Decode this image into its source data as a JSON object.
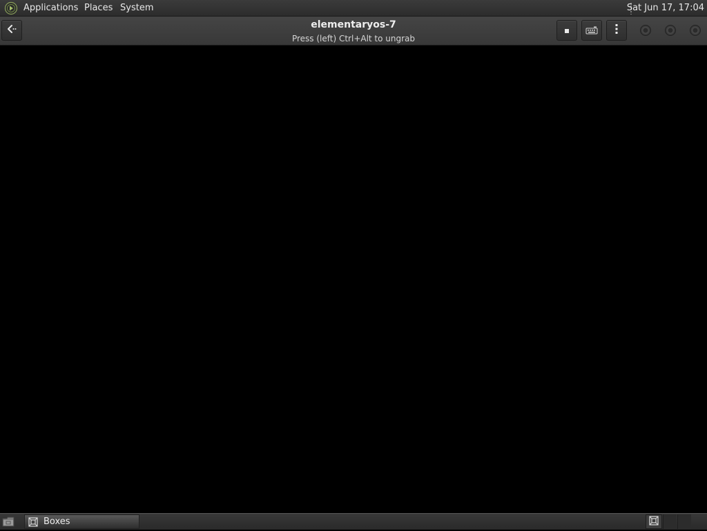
{
  "top_panel": {
    "menus": {
      "applications": "Applications",
      "places": "Places",
      "system": "System"
    },
    "clock": "Sat Jun 17, 17:04",
    "logo_icon": "mate-logo-icon"
  },
  "header_bar": {
    "title": "elementaryos-7",
    "subtitle": "Press (left) Ctrl+Alt to ungrab",
    "buttons": {
      "back": "go-back-icon",
      "send_keys": "stop-icon",
      "keyboard": "keyboard-icon",
      "menu": "view-more-icon"
    },
    "window_controls": [
      "minimize",
      "maximize",
      "close"
    ]
  },
  "taskbar": {
    "items": [
      {
        "label": "Boxes",
        "icon": "boxes-icon"
      }
    ],
    "show_desktop_icon": "show-desktop-icon"
  },
  "colors": {
    "panel": "#2f2f2f",
    "header": "#3e3e3e",
    "display": "#000000",
    "text": "#e8e8e8"
  }
}
